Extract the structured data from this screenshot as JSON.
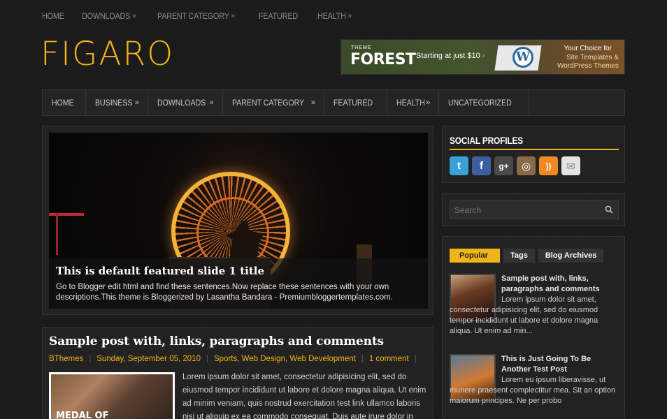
{
  "top_nav": [
    {
      "label": "HOME",
      "arrow": ""
    },
    {
      "label": "DOWNLOADS",
      "arrow": "»"
    },
    {
      "label": "PARENT CATEGORY",
      "arrow": "»"
    },
    {
      "label": "FEATURED",
      "arrow": ""
    },
    {
      "label": "HEALTH",
      "arrow": "»"
    }
  ],
  "logo": "FIGARO",
  "banner": {
    "brand_small": "THEME",
    "brand": "FOREST",
    "starting": "Starting at just $10",
    "arrow": "›",
    "wp_letter": "W",
    "line1": "Your Choice for",
    "line2": "Site Templates & WordPress Themes"
  },
  "main_nav": [
    {
      "label": "HOME",
      "arrow": ""
    },
    {
      "label": "BUSINESS",
      "arrow": "»"
    },
    {
      "label": "DOWNLOADS",
      "arrow": "»"
    },
    {
      "label": "PARENT CATEGORY",
      "arrow": "»"
    },
    {
      "label": "FEATURED",
      "arrow": ""
    },
    {
      "label": "HEALTH",
      "arrow": "»"
    },
    {
      "label": "UNCATEGORIZED",
      "arrow": ""
    }
  ],
  "slider": {
    "title": "This is default featured slide 1 title",
    "text": "Go to Blogger edit html and find these sentences.Now replace these sentences with your own descriptions.This theme is Bloggerized by Lasantha Bandara - Premiumbloggertemplates.com."
  },
  "post": {
    "title": "Sample post with, links, paragraphs and comments",
    "author": "BThemes",
    "date": "Sunday, September 05, 2010",
    "categories": "Sports, Web Design, Web Development",
    "comments": "1 comment",
    "thumb_text": "MEDAL OF",
    "excerpt": "Lorem ipsum dolor sit amet, consectetur adipisicing elit, sed do eiusmod tempor incididunt ut labore et dolore magna aliqua. Ut enim ad minim veniam, quis nostrud exercitation test link ullamco laboris nisi ut aliquip ex ea commodo consequat. Duis aute irure dolor in"
  },
  "social": {
    "title": "SOCIAL PROFILES",
    "icons": [
      {
        "name": "twitter-icon",
        "glyph": "t",
        "color": "#3aa0d8"
      },
      {
        "name": "facebook-icon",
        "glyph": "f",
        "color": "#3b5ea0"
      },
      {
        "name": "googleplus-icon",
        "glyph": "g+",
        "color": "#4a4a4a"
      },
      {
        "name": "instagram-icon",
        "glyph": "◎",
        "color": "#8a6a4a"
      },
      {
        "name": "rss-icon",
        "glyph": "))",
        "color": "#f08a20"
      },
      {
        "name": "email-icon",
        "glyph": "✉",
        "color": "#e4e4e4"
      }
    ]
  },
  "search": {
    "placeholder": "Search"
  },
  "tabs": [
    {
      "label": "Popular",
      "active": true
    },
    {
      "label": "Tags",
      "active": false
    },
    {
      "label": "Blog Archives",
      "active": false
    }
  ],
  "popular": [
    {
      "title": "Sample post with, links, paragraphs and comments",
      "text": "Lorem ipsum dolor sit amet, consectetur adipisicing elit, sed do eiusmod tempor incididunt ut labore et dolore magna aliqua. Ut enim ad min..."
    },
    {
      "title": "This is Just Going To Be Another Test Post",
      "text": "Lorem eu ipsum liberavisse, ut munere praesent complectitur mea. Sit an option maiorum principes. Ne per probo"
    }
  ],
  "colors": {
    "accent": "#f2b418"
  }
}
